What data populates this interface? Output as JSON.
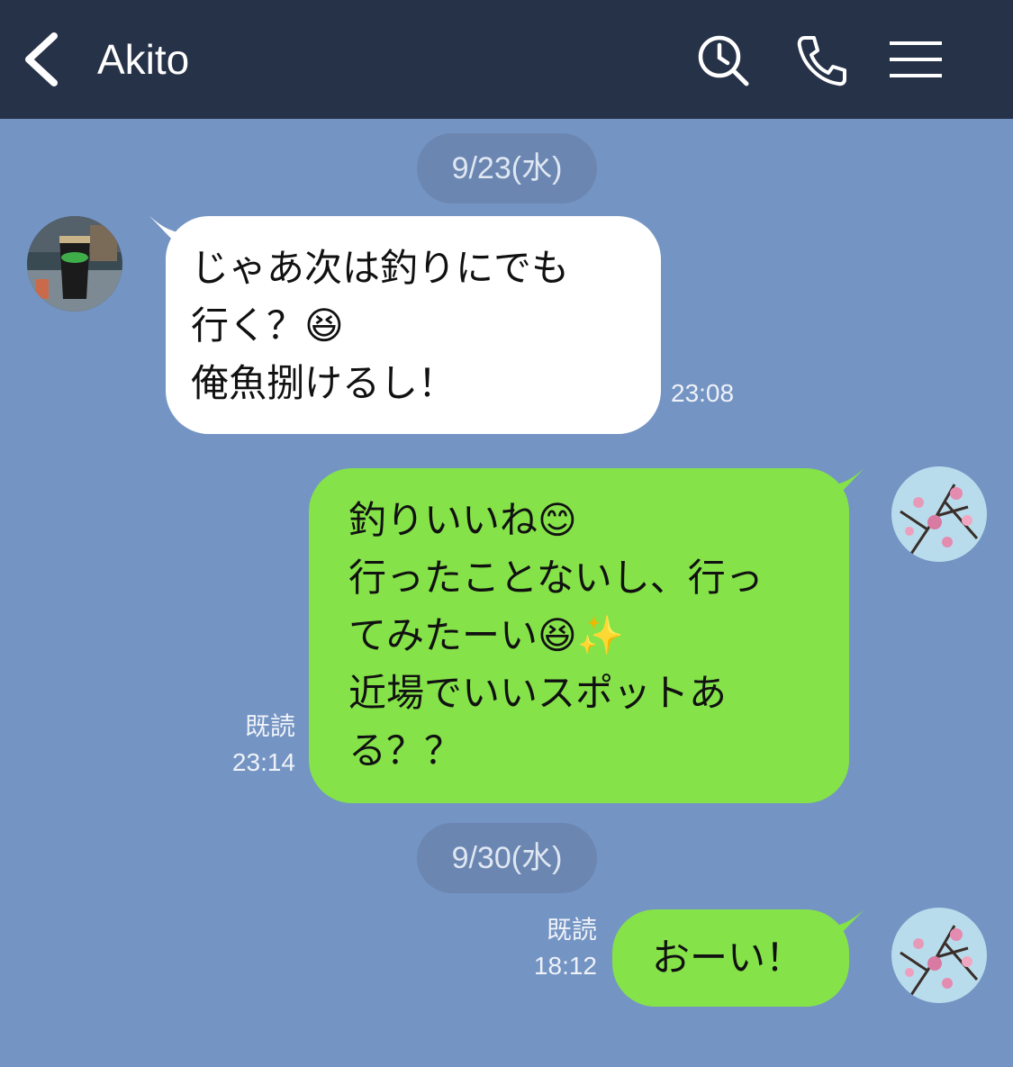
{
  "header": {
    "title": "Akito",
    "icons": [
      "back-chevron-icon",
      "search-clock-icon",
      "phone-icon",
      "menu-icon"
    ]
  },
  "colors": {
    "header_bg": "#263248",
    "chat_bg": "#7494c3",
    "incoming_bubble": "#ffffff",
    "outgoing_bubble": "#85e249"
  },
  "dates": [
    "9/23(水)",
    "9/30(水)"
  ],
  "messages": [
    {
      "from": "Akito",
      "lines": [
        "じゃあ次は釣りにでも",
        "行く？😆",
        "俺魚捌けるし！"
      ],
      "time": "23:08"
    },
    {
      "from": "me",
      "lines": [
        "釣りいいね😊",
        "行ったことないし、行っ",
        "てみたーい😆✨",
        "近場でいいスポットあ",
        "る？？"
      ],
      "read": "既読",
      "time": "23:14"
    },
    {
      "from": "me",
      "lines": [
        "おーい！"
      ],
      "read": "既読",
      "time": "18:12"
    }
  ]
}
